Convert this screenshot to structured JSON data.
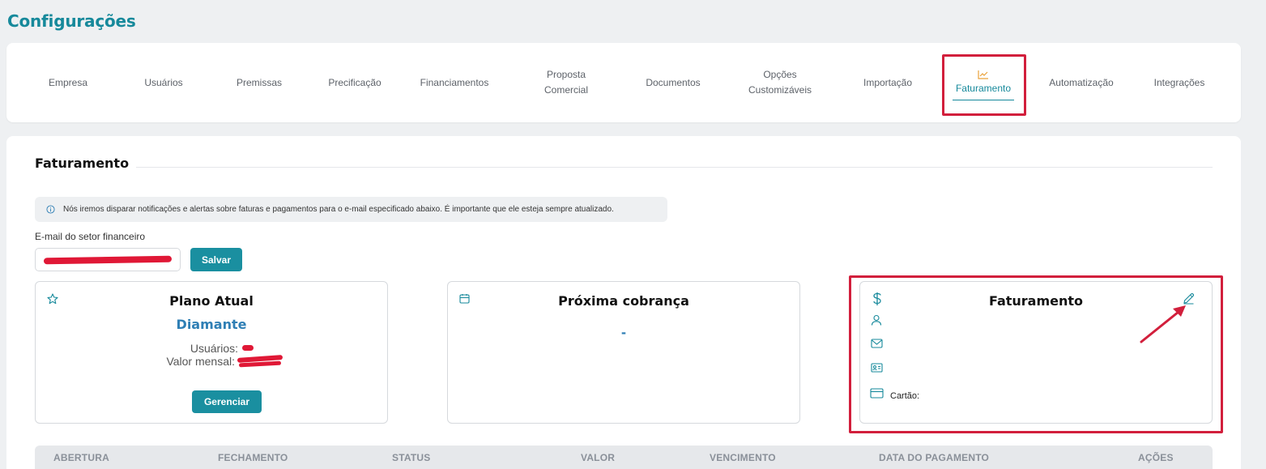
{
  "page": {
    "title": "Configurações"
  },
  "tabs": [
    {
      "label": "Empresa"
    },
    {
      "label": "Usuários"
    },
    {
      "label": "Premissas"
    },
    {
      "label": "Precificação"
    },
    {
      "label": "Financiamentos"
    },
    {
      "label": "Proposta Comercial"
    },
    {
      "label": "Documentos"
    },
    {
      "label": "Opções Customizáveis"
    },
    {
      "label": "Importação"
    },
    {
      "label": "Faturamento",
      "active": true,
      "icon": "chart-line-icon"
    },
    {
      "label": "Automatização"
    },
    {
      "label": "Integrações"
    }
  ],
  "section": {
    "title": "Faturamento",
    "info_text": "Nós iremos disparar notificações e alertas sobre faturas e pagamentos para o e-mail especificado abaixo. É importante que ele esteja sempre atualizado.",
    "email_label": "E-mail do setor financeiro",
    "email_value": "",
    "save_label": "Salvar"
  },
  "plan_card": {
    "title": "Plano Atual",
    "plan_name": "Diamante",
    "users_label": "Usuários:",
    "monthly_label": "Valor mensal:",
    "manage_label": "Gerenciar",
    "icon": "star-icon"
  },
  "next_charge_card": {
    "title": "Próxima cobrança",
    "value": "-",
    "icon": "calendar-icon"
  },
  "billing_card": {
    "title": "Faturamento",
    "card_label": "Cartão:",
    "icons": [
      "dollar-icon",
      "user-icon",
      "mail-icon",
      "id-card-icon",
      "credit-card-icon",
      "pencil-icon"
    ]
  },
  "table": {
    "headers": [
      "ABERTURA",
      "FECHAMENTO",
      "STATUS",
      "VALOR",
      "VENCIMENTO",
      "DATA DO PAGAMENTO",
      "AÇÕES"
    ]
  },
  "colors": {
    "accent": "#16899b",
    "highlight": "#d21f3c",
    "plan": "#2f7fb5"
  }
}
